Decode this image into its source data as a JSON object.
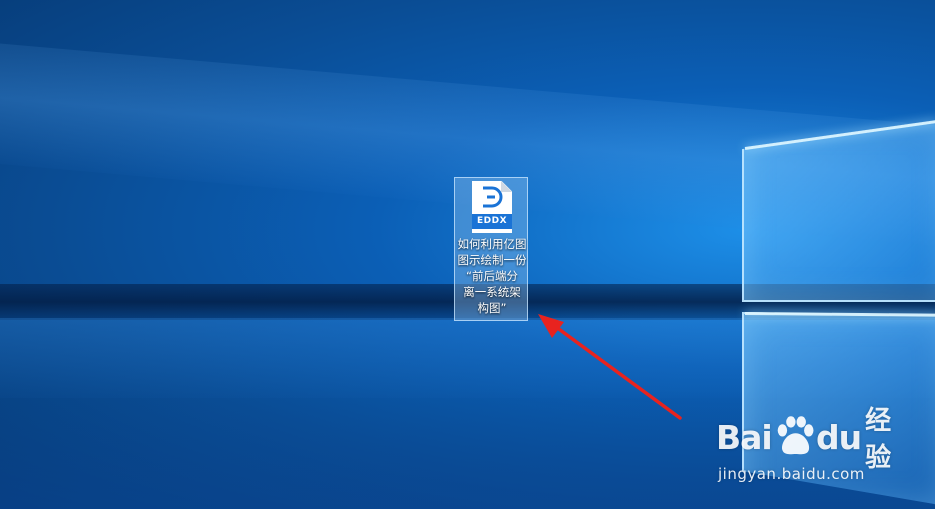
{
  "desktop": {
    "file_icon": {
      "type_badge": "EDDX",
      "label_lines": [
        "如何利用亿图",
        "图示绘制一份",
        "“前后端分",
        "离一系统架",
        "构图”"
      ]
    }
  },
  "watermark": {
    "brand_left": "Bai",
    "brand_right": "du",
    "brand_cn": "经验",
    "url": "jingyan.baidu.com"
  },
  "colors": {
    "desktop_blue": "#0b5fb6",
    "arrow_red": "#e8231f",
    "icon_badge_blue": "#1a73d6"
  },
  "icons": {
    "file_icon": "eddx-document-icon",
    "arrow": "red-arrow-annotation",
    "watermark": "baidu-paw-logo"
  }
}
